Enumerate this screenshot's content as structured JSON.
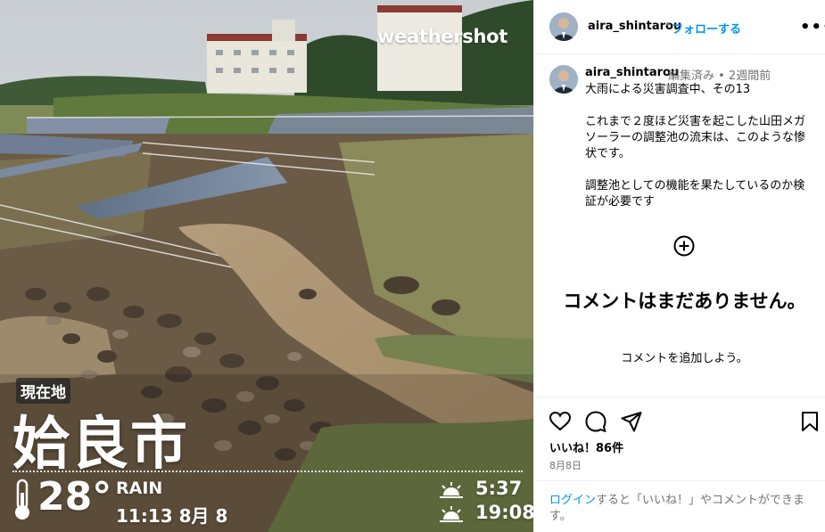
{
  "photo": {
    "watermark": "weathershot",
    "location_badge": "現在地",
    "city": "姶良市",
    "temperature": "28°",
    "condition": "RAIN",
    "datetime": "11:13 8月 8",
    "sunrise": "5:37",
    "sunset": "19:08"
  },
  "header": {
    "username": "aira_shintarou",
    "separator": "•",
    "follow_label": "フォローする",
    "more_icon": "more-options-icon"
  },
  "caption": {
    "username": "aira_shintarou",
    "meta": "編集済み • 2週間前",
    "text": "大雨による災害調査中、その13\n\nこれまで２度ほど災害を起こした山田メガソーラーの調整池の流末は、このような惨状です。\n\n調整池としての機能を果たしているのか検証が必要です"
  },
  "comments": {
    "empty_title": "コメントはまだありません。",
    "empty_subtitle": "コメントを追加しよう。"
  },
  "actions": {
    "likes": "いいね！86件",
    "date": "8月8日"
  },
  "login": {
    "link": "ログイン",
    "text": "すると「いいね！」やコメントができます。"
  },
  "colors": {
    "accent": "#0095f6",
    "muted": "#737373",
    "divider": "#efefef"
  }
}
